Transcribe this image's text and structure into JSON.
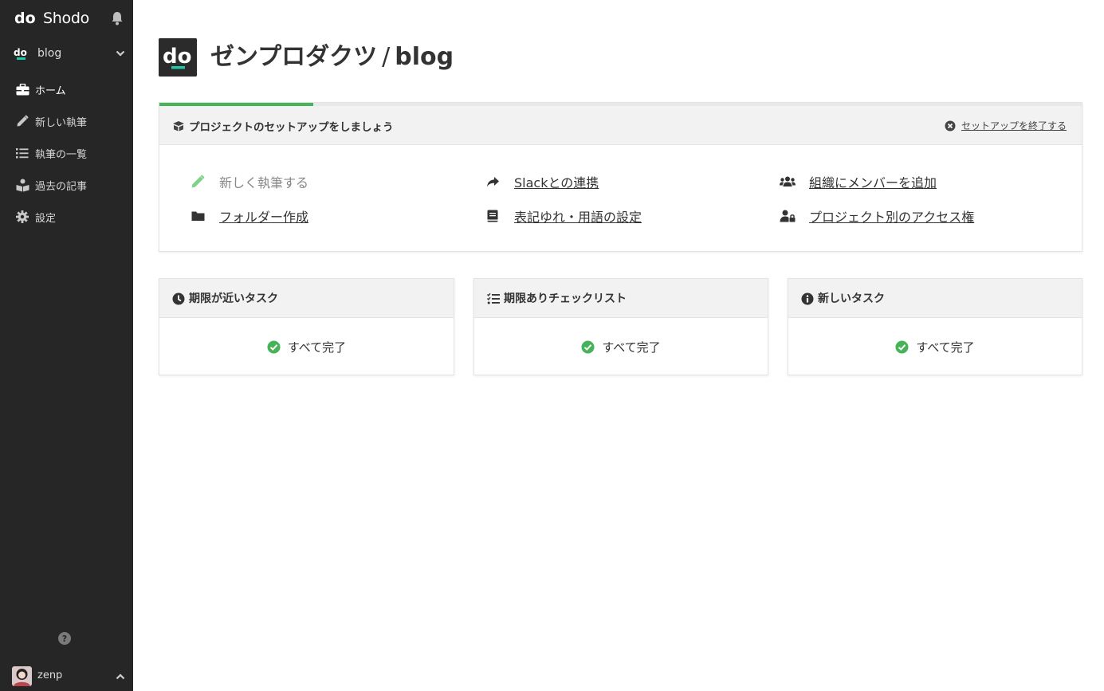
{
  "app": {
    "name": "Shodo"
  },
  "sidebar": {
    "project": {
      "name": "blog"
    },
    "items": [
      {
        "label": "ホーム",
        "icon": "briefcase-icon",
        "active": true
      },
      {
        "label": "新しい執筆",
        "icon": "pencil-icon",
        "active": false
      },
      {
        "label": "執筆の一覧",
        "icon": "list-icon",
        "active": false
      },
      {
        "label": "過去の記事",
        "icon": "book-reader-icon",
        "active": false
      },
      {
        "label": "設定",
        "icon": "gear-icon",
        "active": false
      }
    ],
    "user": {
      "name": "zenp"
    }
  },
  "header": {
    "org": "ゼンプロダクツ",
    "separator": "/",
    "project": "blog"
  },
  "setup": {
    "title": "プロジェクトのセットアップをしましょう",
    "close_label": "セットアップを終了する",
    "progress": 0.167,
    "steps": [
      {
        "label": "新しく執筆する",
        "icon": "pencil-icon",
        "done": true
      },
      {
        "label": "Slackとの連携",
        "icon": "share-icon",
        "done": false
      },
      {
        "label": "組織にメンバーを追加",
        "icon": "users-icon",
        "done": false
      },
      {
        "label": "フォルダー作成",
        "icon": "folder-icon",
        "done": false
      },
      {
        "label": "表記ゆれ・用語の設定",
        "icon": "book-icon",
        "done": false
      },
      {
        "label": "プロジェクト別のアクセス権",
        "icon": "user-lock-icon",
        "done": false
      }
    ]
  },
  "tasks": [
    {
      "title": "期限が近いタスク",
      "icon": "clock-icon",
      "status": "すべて完了"
    },
    {
      "title": "期限ありチェックリスト",
      "icon": "tasks-icon",
      "status": "すべて完了"
    },
    {
      "title": "新しいタスク",
      "icon": "info-icon",
      "status": "すべて完了"
    }
  ],
  "colors": {
    "sidebar_bg": "#262626",
    "accent_green": "#46b358",
    "logo_teal": "#22c6a8",
    "header_bg": "#f2f2f2"
  }
}
